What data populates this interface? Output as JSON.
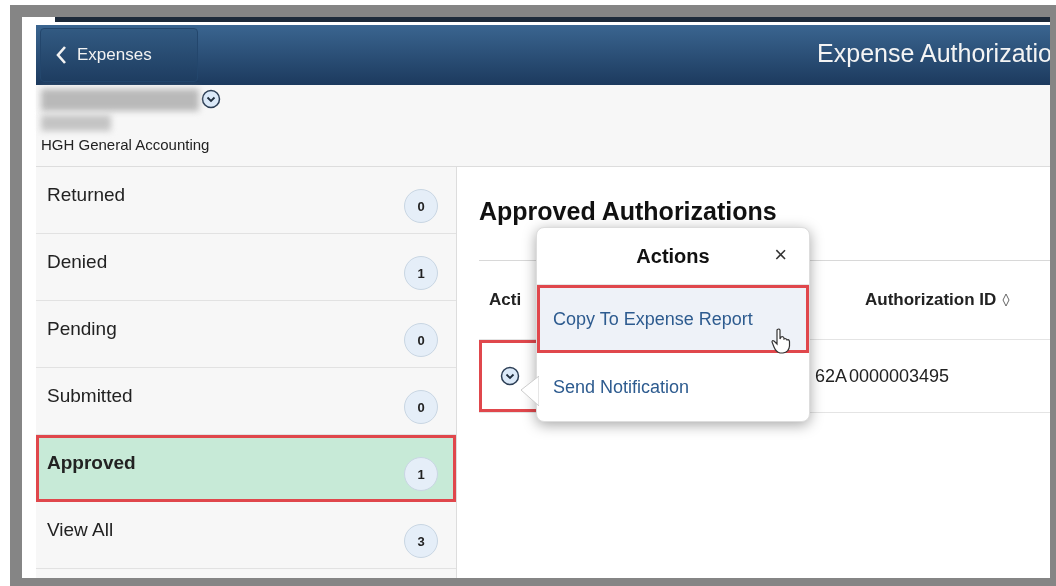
{
  "header": {
    "back_button": "Expenses",
    "title": "Expense Authorizatio"
  },
  "user": {
    "organization": "HGH General Accounting"
  },
  "sidebar": {
    "items": [
      {
        "label": "Returned",
        "count": "0",
        "selected": false,
        "annotated": false
      },
      {
        "label": "Denied",
        "count": "1",
        "selected": false,
        "annotated": false
      },
      {
        "label": "Pending",
        "count": "0",
        "selected": false,
        "annotated": false
      },
      {
        "label": "Submitted",
        "count": "0",
        "selected": false,
        "annotated": false
      },
      {
        "label": "Approved",
        "count": "1",
        "selected": true,
        "annotated": true
      },
      {
        "label": "View All",
        "count": "3",
        "selected": false,
        "annotated": false
      }
    ]
  },
  "main": {
    "heading": "Approved Authorizations",
    "table": {
      "columns": [
        "Acti",
        "Authorization ID"
      ],
      "rows": [
        {
          "action_annotated": true,
          "cells": [
            "62A",
            "0000003495"
          ]
        }
      ]
    }
  },
  "actions_popup": {
    "title": "Actions",
    "close": "×",
    "items": [
      {
        "label": "Copy To Expense Report",
        "selected": true,
        "annotated": true
      },
      {
        "label": "Send Notification",
        "selected": false,
        "annotated": false
      }
    ]
  }
}
